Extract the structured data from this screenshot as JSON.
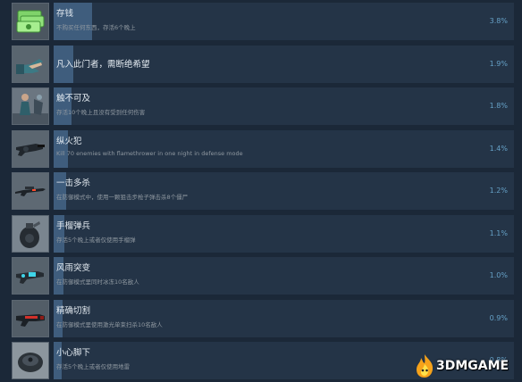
{
  "achievements": [
    {
      "title": "存钱",
      "desc": "不购买任何东西，存活6个晚上",
      "percent_label": "3.8%",
      "fill": 0.038,
      "icon": "cash-stack-icon"
    },
    {
      "title": "凡入此门者，需断绝希望",
      "desc": "",
      "percent_label": "1.9%",
      "fill": 0.019,
      "icon": "pointing-hand-icon"
    },
    {
      "title": "触不可及",
      "desc": "存活10个晚上且没有受到任何伤害",
      "percent_label": "1.8%",
      "fill": 0.018,
      "icon": "untouchable-figure-icon"
    },
    {
      "title": "纵火犯",
      "desc": "Kill 70 enemies with flamethrower in one night in defense mode",
      "percent_label": "1.4%",
      "fill": 0.014,
      "icon": "flamethrower-icon"
    },
    {
      "title": "一击多杀",
      "desc": "在防御模式中，使用一颗狙击步枪子弹击杀8个僵尸",
      "percent_label": "1.2%",
      "fill": 0.012,
      "icon": "sniper-rifle-icon"
    },
    {
      "title": "手榴弹兵",
      "desc": "存活5个晚上或者仅使用手榴弹",
      "percent_label": "1.1%",
      "fill": 0.011,
      "icon": "grenade-icon"
    },
    {
      "title": "风雨突变",
      "desc": "在防御模式里同时冰冻10名敌人",
      "percent_label": "1.0%",
      "fill": 0.01,
      "icon": "freeze-gun-icon"
    },
    {
      "title": "精确切割",
      "desc": "在防御模式里使用激光单束扫杀10名敌人",
      "percent_label": "0.9%",
      "fill": 0.009,
      "icon": "laser-gun-icon"
    },
    {
      "title": "小心脚下",
      "desc": "存活5个晚上或者仅使用地雷",
      "percent_label": "0.8%",
      "fill": 0.008,
      "icon": "landmine-icon"
    }
  ],
  "watermark": {
    "text": "3DMGAME",
    "icon": "flame-logo-icon"
  },
  "colors": {
    "background": "#1b2838",
    "bar": "#243447",
    "fill": "#3f5d7d",
    "percent": "#66a1c7",
    "title": "#e5ecf2",
    "desc": "#8f98a0"
  }
}
